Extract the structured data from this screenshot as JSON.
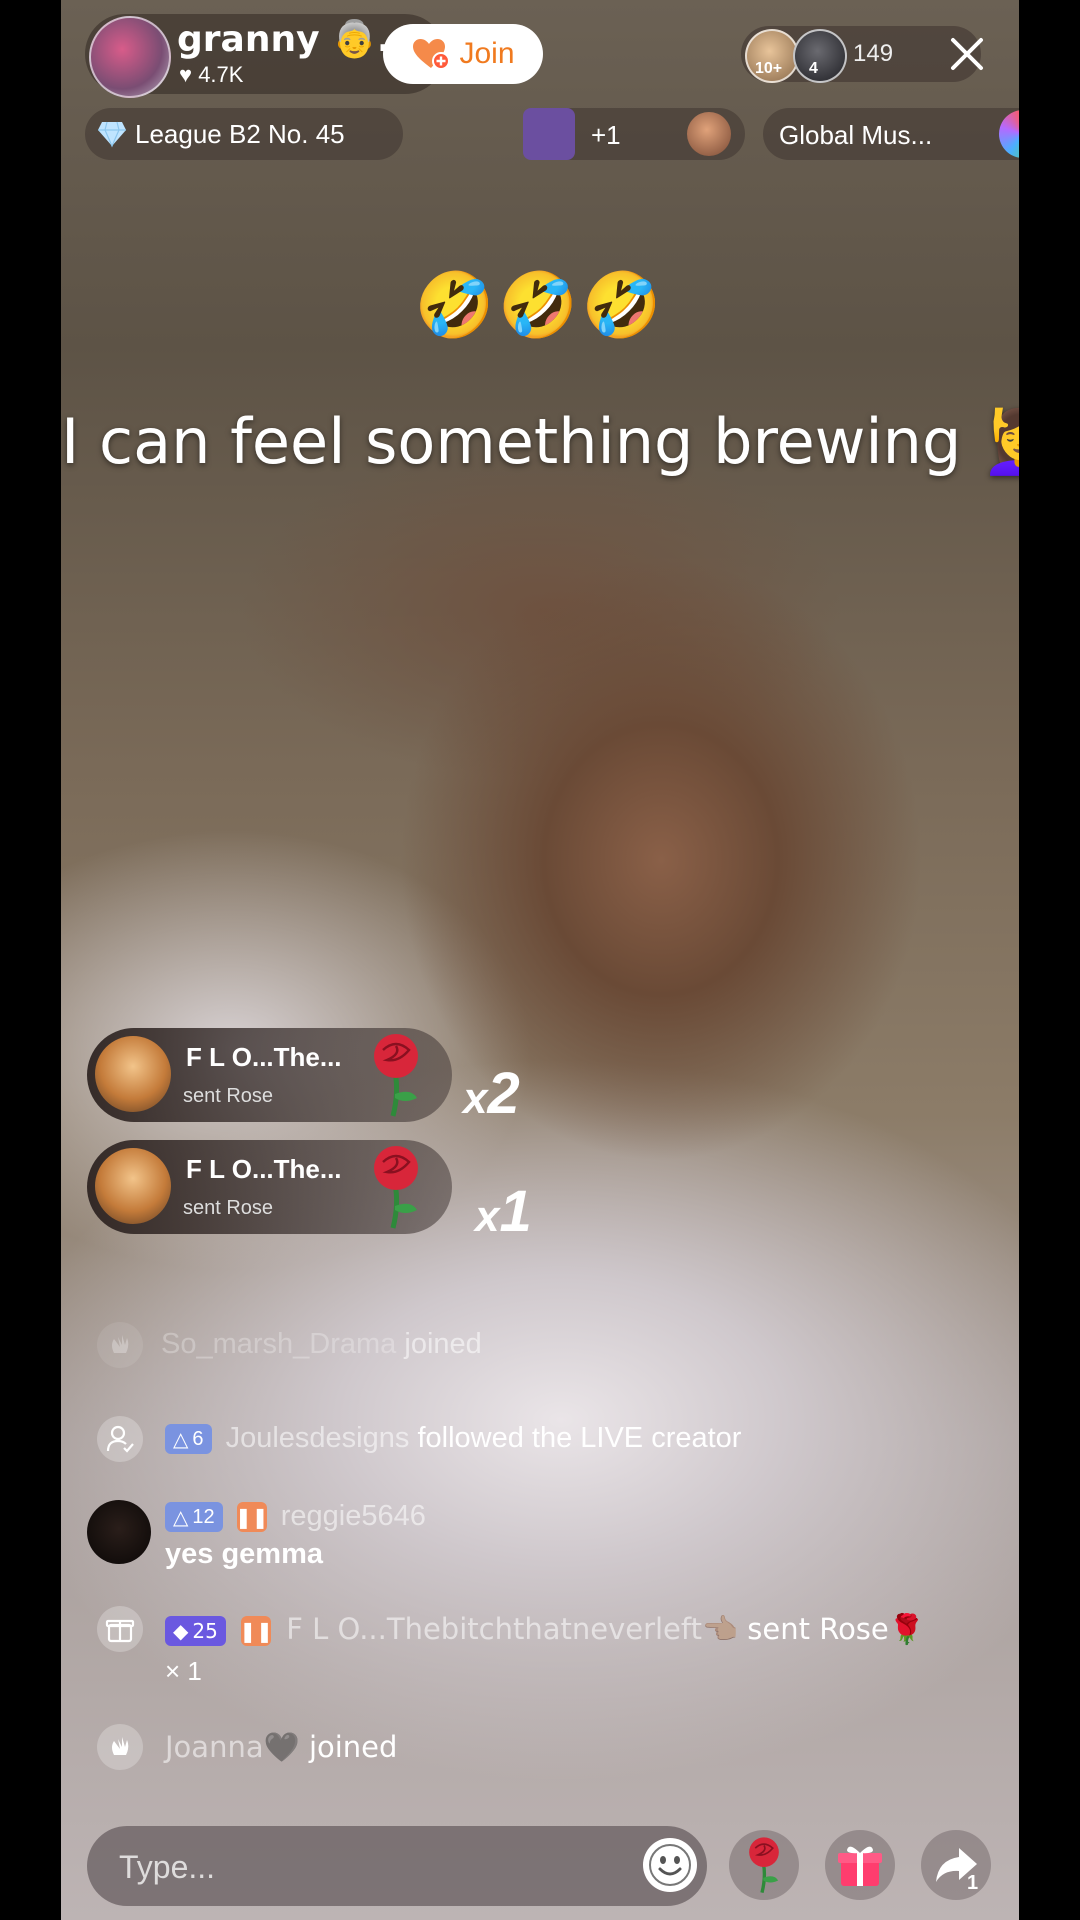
{
  "header": {
    "host_name": "granny 👵...",
    "host_likes": "4.7K",
    "join_label": "Join",
    "viewer_badges": [
      "10+",
      "4"
    ],
    "viewer_count": "149",
    "league_label": "League B2 No. 45",
    "rank_more": "+1",
    "music_label": "Global Mus..."
  },
  "overlay": {
    "emojis": "🤣🤣🤣",
    "caption": "I can feel something brewing 💆‍♀️"
  },
  "gift_banners": [
    {
      "name": "F L O...The...",
      "action": "sent Rose",
      "count_prefix": "x",
      "count": "2"
    },
    {
      "name": "F L O...The...",
      "action": "sent Rose",
      "count_prefix": "x",
      "count": "1"
    }
  ],
  "chat": {
    "join1_user": "So_marsh_Drama",
    "join1_action": "joined",
    "follow_badge": "6",
    "follow_user": "Joulesdesigns",
    "follow_action": "followed the LIVE creator",
    "comment_badge": "12",
    "comment_user": "reggie5646",
    "comment_text": "yes gemma",
    "gift_badge": "25",
    "gift_user": "F L O...Thebitchthatneverleft👈🏽",
    "gift_action": "sent Rose🌹",
    "gift_count": "× 1",
    "join2_user": "Joanna🖤",
    "join2_action": "joined"
  },
  "bottom": {
    "placeholder": "Type...",
    "share_count": "1"
  },
  "colors": {
    "join_accent": "#f07a1f",
    "badge_blue": "#7a93e0",
    "badge_purple": "#6a58e0",
    "rose_red": "#d8263a",
    "gift_pink": "#ff3d6e"
  }
}
